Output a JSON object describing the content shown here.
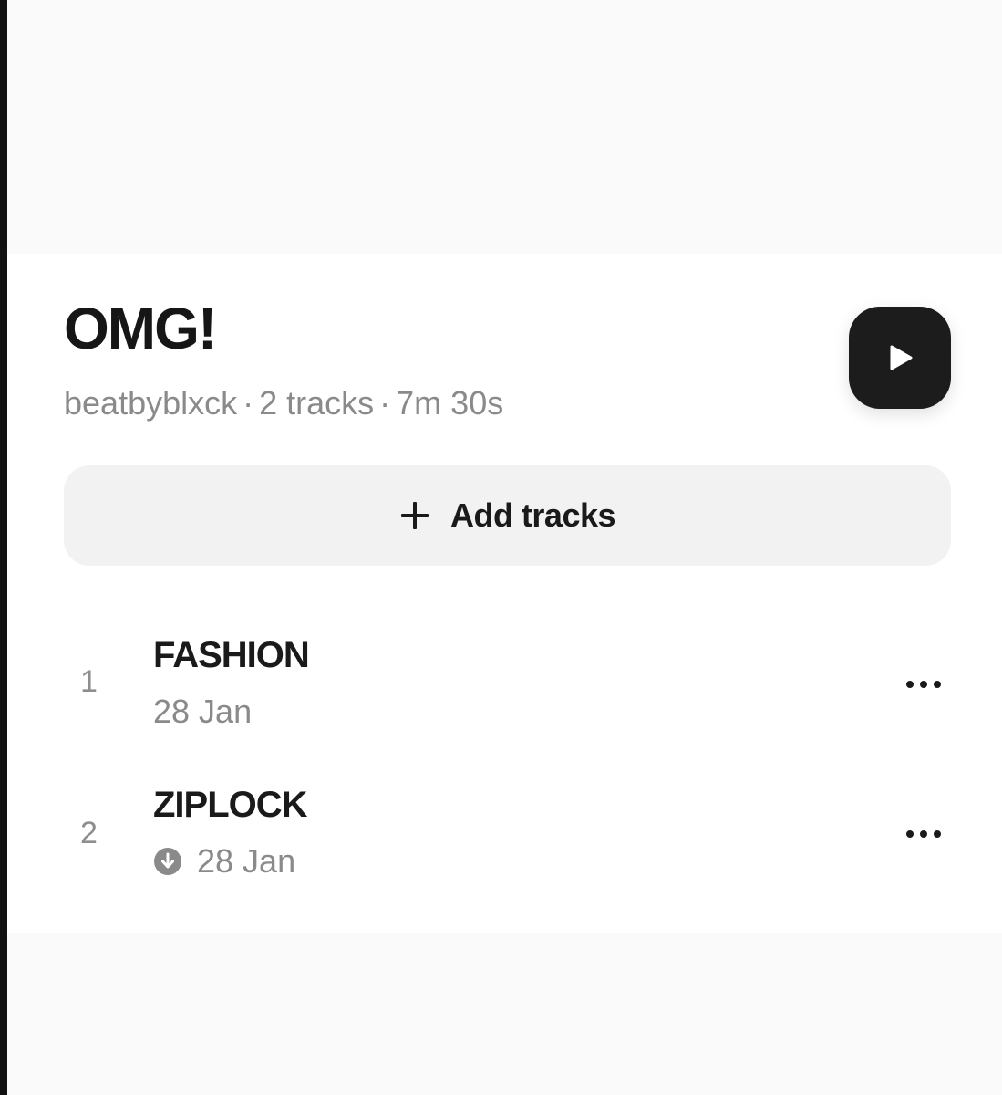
{
  "playlist": {
    "title": "OMG!",
    "owner": "beatbyblxck",
    "separator": "·",
    "track_count": "2 tracks",
    "duration": "7m 30s"
  },
  "actions": {
    "add_tracks_label": "Add tracks"
  },
  "tracks": [
    {
      "number": "1",
      "name": "FASHION",
      "date": "28 Jan",
      "downloaded": false
    },
    {
      "number": "2",
      "name": "ZIPLOCK",
      "date": "28 Jan",
      "downloaded": true
    }
  ],
  "icons": {
    "play": "play-icon",
    "add": "plus-icon",
    "more": "more-horizontal-icon",
    "downloaded": "download-icon"
  },
  "colors": {
    "page_bg": "#fafafa",
    "card_bg": "#ffffff",
    "primary_text": "#1a1a1a",
    "secondary_text": "#8a8a8a",
    "play_button_bg": "#1c1c1c",
    "add_button_bg": "#f2f2f2"
  }
}
